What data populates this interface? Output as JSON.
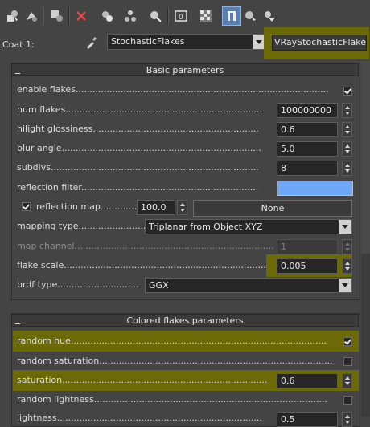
{
  "toolbar": {
    "buttons": [
      {
        "name": "get-material-icon",
        "active": false
      },
      {
        "name": "put-to-scene-icon",
        "active": false
      },
      {
        "name": "assign-to-selection-icon",
        "active": false
      },
      {
        "name": "reset-map-icon",
        "active": false
      },
      {
        "name": "copy-material-icon",
        "active": false
      },
      {
        "name": "make-unique-icon",
        "active": false
      },
      {
        "name": "put-to-library-icon",
        "active": false
      },
      {
        "name": "material-id-channel-icon",
        "active": false
      },
      {
        "name": "show-shaded-material-icon",
        "active": false
      },
      {
        "name": "show-end-result-icon",
        "active": true
      },
      {
        "name": "go-to-parent-icon",
        "active": false
      },
      {
        "name": "go-forward-sibling-icon",
        "active": false
      }
    ]
  },
  "coat": {
    "label": "Coat 1:",
    "map_name": "StochasticFlakes",
    "map_type": "VRayStochasticFlakesMtl"
  },
  "basic": {
    "title": "Basic parameters",
    "enable_flakes": {
      "label": "enable flakes",
      "checked": true
    },
    "num_flakes": {
      "label": "num flakes",
      "value": "100000000"
    },
    "hilight_glossiness": {
      "label": "hilight glossiness",
      "value": "0.6"
    },
    "blur_angle": {
      "label": "blur angle",
      "value": "5.0"
    },
    "subdivs": {
      "label": "subdivs",
      "value": "8"
    },
    "reflection_filter": {
      "label": "reflection filter",
      "color": "#6fa6f5"
    },
    "reflection_map": {
      "label": "reflection map",
      "checked": true,
      "amount": "100.0",
      "map": "None"
    },
    "mapping_type": {
      "label": "mapping type",
      "value": "Triplanar from Object XYZ"
    },
    "map_channel": {
      "label": "map channel",
      "value": "1"
    },
    "flake_scale": {
      "label": "flake scale",
      "value": "0.005"
    },
    "brdf_type": {
      "label": "brdf type",
      "value": "GGX"
    }
  },
  "colored": {
    "title": "Colored flakes parameters",
    "random_hue": {
      "label": "random hue",
      "checked": true
    },
    "random_saturation": {
      "label": "random saturation",
      "checked": false
    },
    "saturation": {
      "label": "saturation",
      "value": "0.6"
    },
    "random_lightness": {
      "label": "random lightness",
      "checked": false
    },
    "lightness": {
      "label": "lightness",
      "value": "0.5"
    }
  },
  "colors": {
    "highlight": "#6b6a07",
    "active_button": "#5a7fb2",
    "swatch": "#6fa6f5"
  }
}
